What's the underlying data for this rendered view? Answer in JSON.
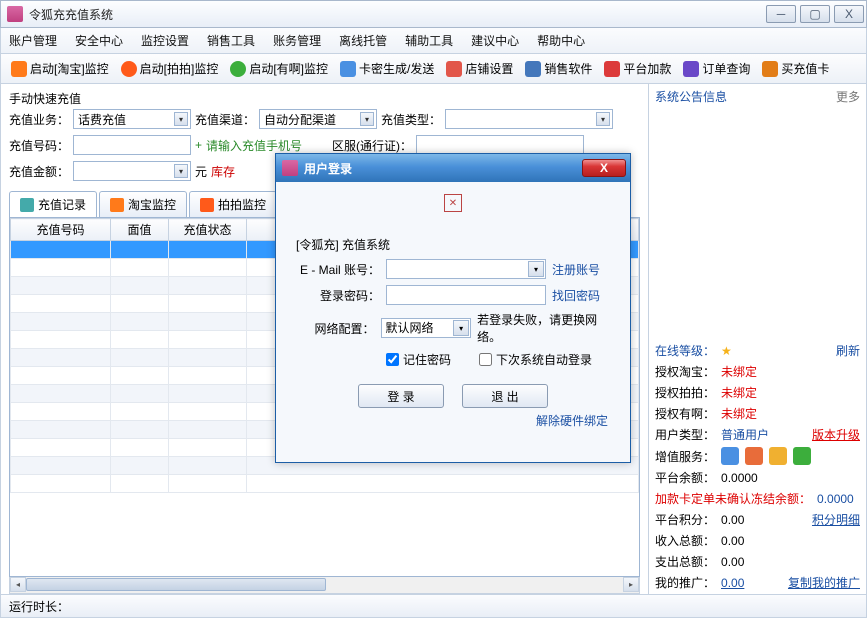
{
  "window": {
    "title": "令狐充充值系统"
  },
  "menus": [
    "账户管理",
    "安全中心",
    "监控设置",
    "销售工具",
    "账务管理",
    "离线托管",
    "辅助工具",
    "建议中心",
    "帮助中心"
  ],
  "toolbar": [
    {
      "icon": "ic-tb",
      "label": "启动[淘宝]监控"
    },
    {
      "icon": "ic-pp",
      "label": "启动[拍拍]监控"
    },
    {
      "icon": "ic-yz",
      "label": "启动[有啊]监控"
    },
    {
      "icon": "ic-card",
      "label": "卡密生成/发送"
    },
    {
      "icon": "ic-shop",
      "label": "店铺设置"
    },
    {
      "icon": "ic-soft",
      "label": "销售软件"
    },
    {
      "icon": "ic-plat",
      "label": "平台加款"
    },
    {
      "icon": "ic-ord",
      "label": "订单查询"
    },
    {
      "icon": "ic-buy",
      "label": "买充值卡"
    }
  ],
  "quick": {
    "title": "手动快速充值",
    "biz_label": "充值业务：",
    "biz_value": "话费充值",
    "channel_label": "充值渠道：",
    "channel_value": "自动分配渠道",
    "type_label": "充值类型：",
    "num_label": "充值号码：",
    "num_hint": "请输入充值手机号",
    "num_prefix": "+",
    "area_label": "区服(通行证)：",
    "amt_label": "充值金额：",
    "amt_unit": "元",
    "stock_label": "库存"
  },
  "tabs": [
    {
      "label": "充值记录"
    },
    {
      "label": "淘宝监控"
    },
    {
      "label": "拍拍监控"
    }
  ],
  "table_headers": [
    "充值号码",
    "面值",
    "充值状态"
  ],
  "right": {
    "notice_title": "系统公告信息",
    "more": "更多",
    "online_label": "在线等级：",
    "refresh": "刷新",
    "auth_tb": "授权淘宝：",
    "auth_pp": "授权拍拍：",
    "auth_yz": "授权有啊：",
    "unbound": "未绑定",
    "usertype_label": "用户类型：",
    "usertype_value": "普通用户",
    "upgrade": "版本升级",
    "vas_label": "增值服务：",
    "balance_label": "平台余额：",
    "balance_value": "0.0000",
    "freeze_label": "加款卡定单未确认冻结余额：",
    "freeze_value": "0.0000",
    "points_label": "平台积分：",
    "points_value": "0.00",
    "points_detail": "积分明细",
    "income_label": "收入总额：",
    "income_value": "0.00",
    "expense_label": "支出总额：",
    "expense_value": "0.00",
    "promo_label": "我的推广：",
    "promo_value": "0.00",
    "promo_copy": "复制我的推广"
  },
  "status": {
    "runtime_label": "运行时长："
  },
  "dialog": {
    "title": "用户登录",
    "sys": "[令狐充] 充值系统",
    "email_label": "E - Mail 账号：",
    "email_link": "注册账号",
    "pwd_label": "登录密码：",
    "pwd_link": "找回密码",
    "net_label": "网络配置：",
    "net_value": "默认网络",
    "net_hint": "若登录失败，请更换网络。",
    "remember": "记住密码",
    "autologin": "下次系统自动登录",
    "login_btn": "登 录",
    "exit_btn": "退 出",
    "foot_link": "解除硬件绑定"
  }
}
